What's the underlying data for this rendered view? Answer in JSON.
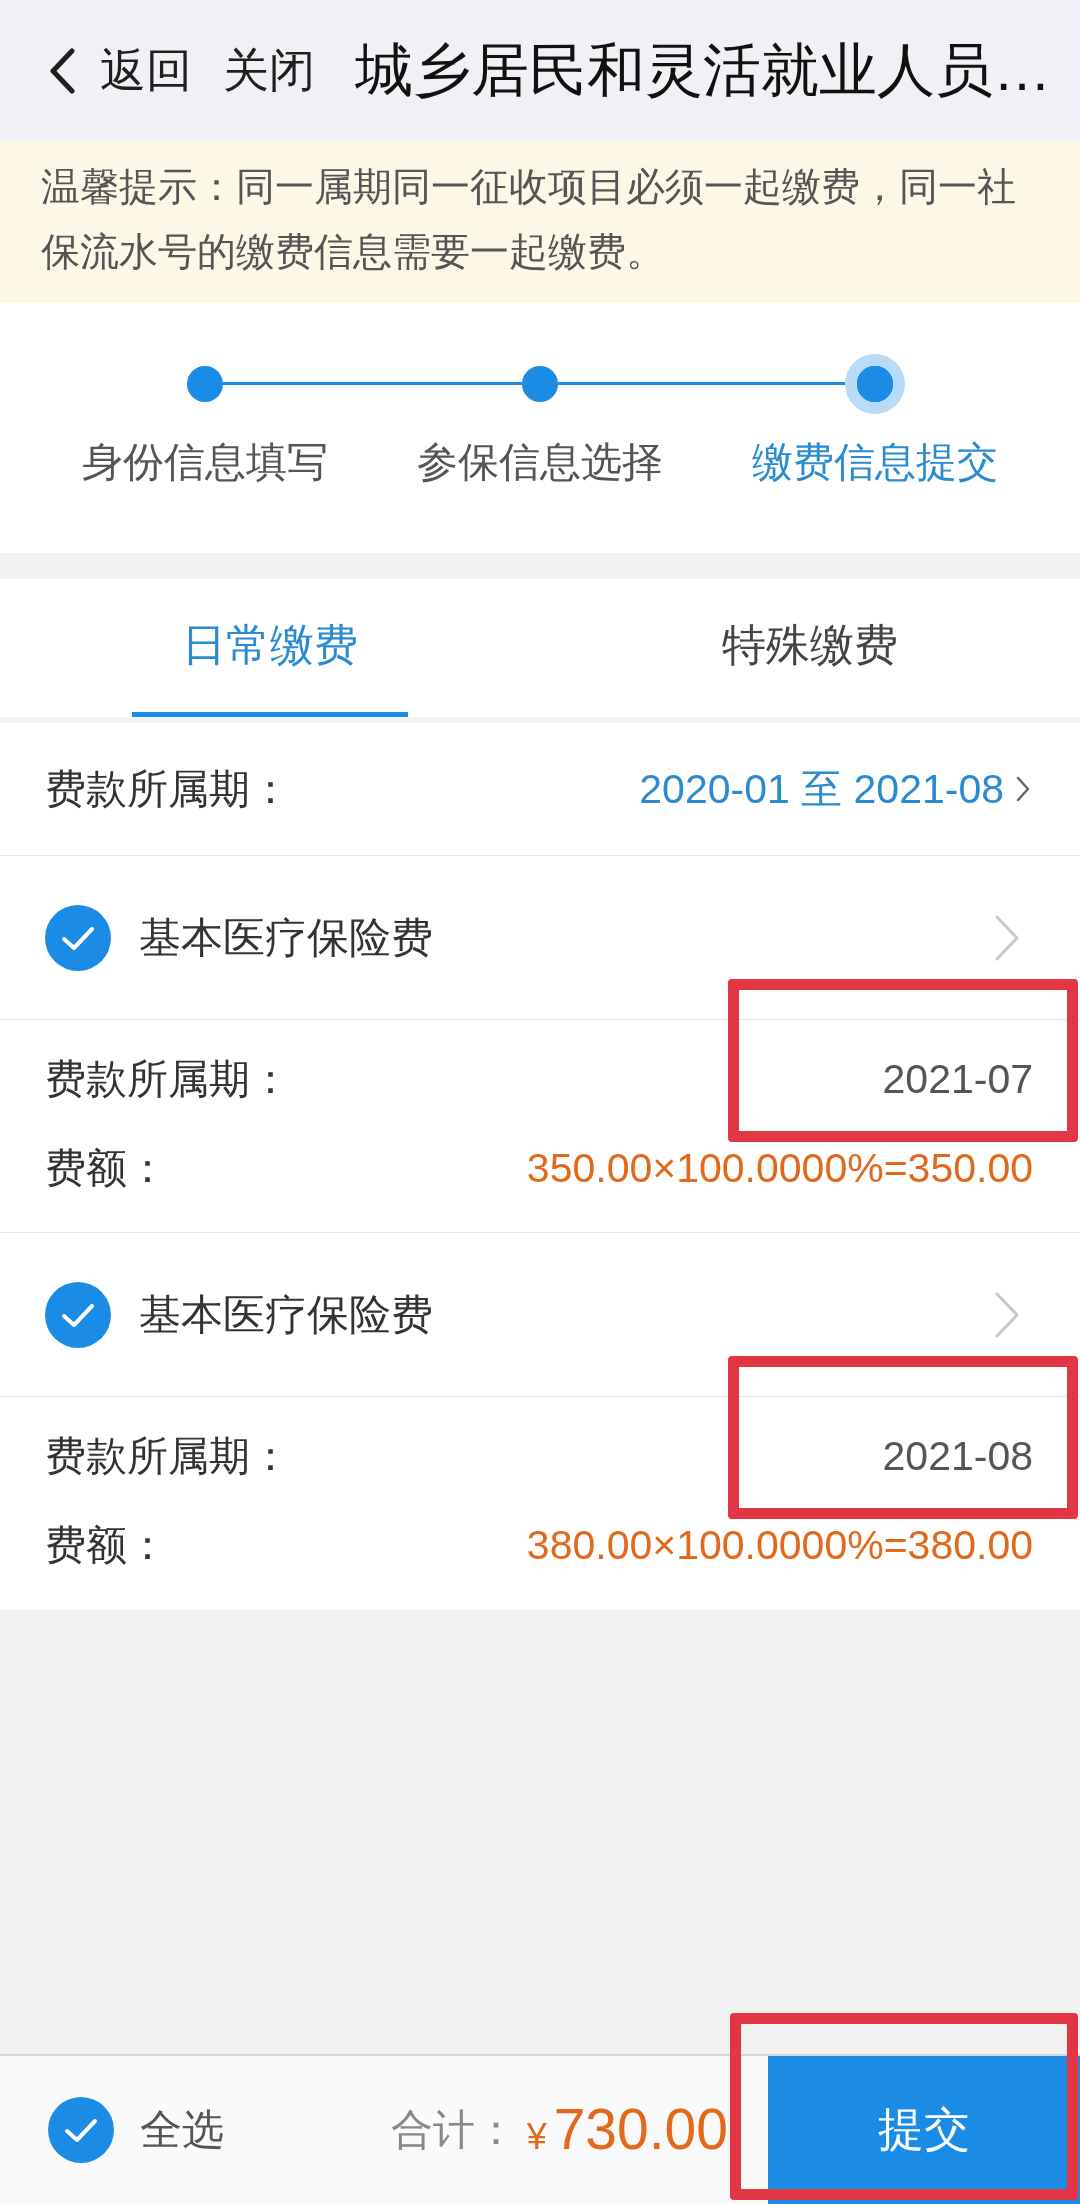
{
  "header": {
    "back": "返回",
    "close": "关闭",
    "title": "城乡居民和灵活就业人员…"
  },
  "notice": "温馨提示：同一属期同一征收项目必须一起缴费，同一社保流水号的缴费信息需要一起缴费。",
  "steps": [
    {
      "label": "身份信息填写",
      "selected": false
    },
    {
      "label": "参保信息选择",
      "selected": false
    },
    {
      "label": "缴费信息提交",
      "selected": true
    }
  ],
  "tabs": [
    {
      "label": "日常缴费",
      "selected": true
    },
    {
      "label": "特殊缴费",
      "selected": false
    }
  ],
  "period_filter": {
    "label": "费款所属期：",
    "value": "2020-01 至 2021-08"
  },
  "items": [
    {
      "name": "基本医疗保险费",
      "checked": true,
      "period_label": "费款所属期：",
      "period": "2021-07",
      "period_highlighted": true,
      "amount_label": "费额：",
      "amount": "350.00×100.0000%=350.00"
    },
    {
      "name": "基本医疗保险费",
      "checked": true,
      "period_label": "费款所属期：",
      "period": "2021-08",
      "period_highlighted": true,
      "amount_label": "费额：",
      "amount": "380.00×100.0000%=380.00"
    }
  ],
  "footer": {
    "select_all": {
      "label": "全选",
      "checked": true
    },
    "total_label": "合计：",
    "total": {
      "currency": "¥",
      "value": "730.00"
    },
    "submit": {
      "label": "提交",
      "highlighted": true
    }
  }
}
